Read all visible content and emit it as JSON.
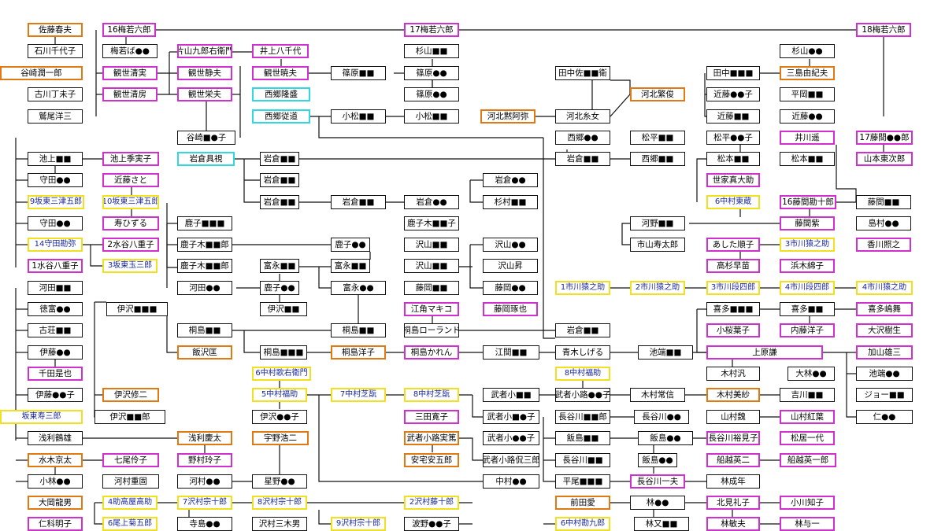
{
  "colors": {
    "black": "#111111",
    "orange": "#e07a10",
    "magenta": "#d030d0",
    "yellow": "#f0e020",
    "cyan": "#30d8e0",
    "blue_text": "#1a2aa0"
  },
  "nodes": [
    {
      "t": "佐藤春夫",
      "c": "o"
    },
    {
      "t": "石川千代子",
      "c": "b"
    },
    {
      "t": "谷崎潤一郎",
      "c": "o"
    },
    {
      "t": "古川丁未子",
      "c": "b"
    },
    {
      "t": "鷲尾洋三",
      "c": "b"
    },
    {
      "t": "16梅若六郎",
      "c": "m"
    },
    {
      "t": "梅若ば●●",
      "c": "b"
    },
    {
      "t": "観世清実",
      "c": "m"
    },
    {
      "t": "観世清房",
      "c": "m"
    },
    {
      "t": "片山九郎右衛門",
      "c": "m"
    },
    {
      "t": "観世静夫",
      "c": "m"
    },
    {
      "t": "観世栄夫",
      "c": "m"
    },
    {
      "t": "井上八千代",
      "c": "m"
    },
    {
      "t": "観世暁夫",
      "c": "m"
    },
    {
      "t": "西郷隆盛",
      "c": "c"
    },
    {
      "t": "西郷従道",
      "c": "c"
    },
    {
      "t": "17梅若六郎",
      "c": "m"
    },
    {
      "t": "篠原■■",
      "c": "b"
    },
    {
      "t": "篠原●●",
      "c": "b"
    },
    {
      "t": "篠原●●",
      "c": "b"
    },
    {
      "t": "小松■■",
      "c": "b"
    },
    {
      "t": "小松■■",
      "c": "b"
    },
    {
      "t": "杉山■■",
      "c": "b"
    },
    {
      "t": "田中佐■■衛",
      "c": "b"
    },
    {
      "t": "河北繁俊",
      "c": "o"
    },
    {
      "t": "河北黙阿弥",
      "c": "o"
    },
    {
      "t": "河北糸女",
      "c": "b"
    },
    {
      "t": "田中■■■",
      "c": "b"
    },
    {
      "t": "近藤●●子",
      "c": "b"
    },
    {
      "t": "近藤■■",
      "c": "b"
    },
    {
      "t": "杉山●●",
      "c": "b"
    },
    {
      "t": "三島由紀夫",
      "c": "o"
    },
    {
      "t": "平岡■■",
      "c": "b"
    },
    {
      "t": "近藤●●",
      "c": "b"
    },
    {
      "t": "18梅若六郎",
      "c": "m"
    },
    {
      "t": "谷崎■●子",
      "c": "b"
    },
    {
      "t": "西郷●●",
      "c": "b"
    },
    {
      "t": "松平■■",
      "c": "b"
    },
    {
      "t": "松平●●子",
      "c": "b"
    },
    {
      "t": "井川遥",
      "c": "m"
    },
    {
      "t": "17藤間●●郎",
      "c": "m"
    },
    {
      "t": "池上■■",
      "c": "b"
    },
    {
      "t": "池上季実子",
      "c": "m"
    },
    {
      "t": "岩倉具視",
      "c": "c"
    },
    {
      "t": "岩倉■■",
      "c": "b"
    },
    {
      "t": "岩倉■■",
      "c": "b"
    },
    {
      "t": "西郷■■",
      "c": "b"
    },
    {
      "t": "松本■■",
      "c": "b"
    },
    {
      "t": "松本■■",
      "c": "b"
    },
    {
      "t": "山本東次郎",
      "c": "m"
    },
    {
      "t": "守田●●",
      "c": "b"
    },
    {
      "t": "近藤さと",
      "c": "m"
    },
    {
      "t": "岩倉■■",
      "c": "b"
    },
    {
      "t": "岩倉●●",
      "c": "b"
    },
    {
      "t": "世家真大助",
      "c": "m"
    },
    {
      "t": "9坂東三津五郎",
      "c": "y"
    },
    {
      "t": "10坂東三津五郎",
      "c": "y"
    },
    {
      "t": "岩倉■■",
      "c": "b"
    },
    {
      "t": "岩倉■■",
      "c": "b"
    },
    {
      "t": "岩倉●●",
      "c": "b"
    },
    {
      "t": "杉村■■",
      "c": "b"
    },
    {
      "t": "6中村東蔵",
      "c": "y"
    },
    {
      "t": "16藤間勘十郎",
      "c": "m"
    },
    {
      "t": "藤間■■",
      "c": "b"
    },
    {
      "t": "守田●●",
      "c": "b"
    },
    {
      "t": "寿ひずる",
      "c": "m"
    },
    {
      "t": "鹿子■■■",
      "c": "b"
    },
    {
      "t": "鹿子木■■子",
      "c": "b"
    },
    {
      "t": "河野■■",
      "c": "b"
    },
    {
      "t": "藤間紫",
      "c": "m"
    },
    {
      "t": "島村●●",
      "c": "b"
    },
    {
      "t": "14守田勘弥",
      "c": "y"
    },
    {
      "t": "2水谷八重子",
      "c": "m"
    },
    {
      "t": "鹿子木■■郎",
      "c": "b"
    },
    {
      "t": "沢山■■",
      "c": "b"
    },
    {
      "t": "沢山●●",
      "c": "b"
    },
    {
      "t": "市山寿太郎",
      "c": "b"
    },
    {
      "t": "あした順子",
      "c": "m"
    },
    {
      "t": "3市川猿之助",
      "c": "y"
    },
    {
      "t": "香川照之",
      "c": "m"
    },
    {
      "t": "1水谷八重子",
      "c": "m"
    },
    {
      "t": "3坂東玉三郎",
      "c": "y"
    },
    {
      "t": "鹿子木■■郎",
      "c": "b"
    },
    {
      "t": "富永■■",
      "c": "b"
    },
    {
      "t": "鹿子●●",
      "c": "b"
    },
    {
      "t": "富永■■",
      "c": "b"
    },
    {
      "t": "沢山■■",
      "c": "b"
    },
    {
      "t": "沢山昇",
      "c": "b"
    },
    {
      "t": "浜木綿子",
      "c": "m"
    },
    {
      "t": "河田■■",
      "c": "b"
    },
    {
      "t": "河田●●",
      "c": "b"
    },
    {
      "t": "鹿子●●",
      "c": "b"
    },
    {
      "t": "富永●●",
      "c": "b"
    },
    {
      "t": "藤岡■■",
      "c": "b"
    },
    {
      "t": "藤岡●●",
      "c": "b"
    },
    {
      "t": "高杉早苗",
      "c": "m"
    },
    {
      "t": "1市川猿之助",
      "c": "y"
    },
    {
      "t": "2市川猿之助",
      "c": "y"
    },
    {
      "t": "3市川段四郎",
      "c": "y"
    },
    {
      "t": "4市川段四郎",
      "c": "y"
    },
    {
      "t": "4市川猿之助",
      "c": "y"
    },
    {
      "t": "徳富●●",
      "c": "b"
    },
    {
      "t": "伊沢■■■",
      "c": "b"
    },
    {
      "t": "伊沢■■",
      "c": "b"
    },
    {
      "t": "江角マキコ",
      "c": "m"
    },
    {
      "t": "藤岡琢也",
      "c": "m"
    },
    {
      "t": "喜多■■■",
      "c": "b"
    },
    {
      "t": "喜多■■",
      "c": "b"
    },
    {
      "t": "喜多嶋舞",
      "c": "m"
    },
    {
      "t": "古荘■■",
      "c": "b"
    },
    {
      "t": "桐島■■",
      "c": "b"
    },
    {
      "t": "桐島■■",
      "c": "b"
    },
    {
      "t": "桐島ローランド",
      "c": "b"
    },
    {
      "t": "岩倉■■",
      "c": "b"
    },
    {
      "t": "小桜葉子",
      "c": "m"
    },
    {
      "t": "内藤洋子",
      "c": "m"
    },
    {
      "t": "大沢樹生",
      "c": "m"
    },
    {
      "t": "伊藤●●",
      "c": "b"
    },
    {
      "t": "飯沢匡",
      "c": "o"
    },
    {
      "t": "桐島■■■",
      "c": "b"
    },
    {
      "t": "桐島洋子",
      "c": "o"
    },
    {
      "t": "桐島かれん",
      "c": "m"
    },
    {
      "t": "江間■■",
      "c": "b"
    },
    {
      "t": "青木しげる",
      "c": "b"
    },
    {
      "t": "池端■■",
      "c": "b"
    },
    {
      "t": "上原謙",
      "c": "m"
    },
    {
      "t": "加山雄三",
      "c": "m"
    },
    {
      "t": "千田是也",
      "c": "m"
    },
    {
      "t": "6中村歌右衛門",
      "c": "y"
    },
    {
      "t": "8中村福助",
      "c": "y"
    },
    {
      "t": "木村汎",
      "c": "b"
    },
    {
      "t": "大林●●",
      "c": "b"
    },
    {
      "t": "池端●●",
      "c": "b"
    },
    {
      "t": "伊藤●●子",
      "c": "b"
    },
    {
      "t": "伊沢修二",
      "c": "o"
    },
    {
      "t": "5中村福助",
      "c": "y"
    },
    {
      "t": "7中村芝翫",
      "c": "y"
    },
    {
      "t": "8中村芝翫",
      "c": "y"
    },
    {
      "t": "武者小■■",
      "c": "b"
    },
    {
      "t": "武者小路●●子",
      "c": "b"
    },
    {
      "t": "木村常信",
      "c": "b"
    },
    {
      "t": "木村美紗",
      "c": "o"
    },
    {
      "t": "吉川■■",
      "c": "b"
    },
    {
      "t": "ジョー■■",
      "c": "b"
    },
    {
      "t": "坂東寿三郎",
      "c": "y"
    },
    {
      "t": "伊沢■■郎",
      "c": "b"
    },
    {
      "t": "伊沢●●子",
      "c": "b"
    },
    {
      "t": "三田寛子",
      "c": "m"
    },
    {
      "t": "武者小■●子",
      "c": "b"
    },
    {
      "t": "長谷川■■郎",
      "c": "b"
    },
    {
      "t": "長谷川●●",
      "c": "b"
    },
    {
      "t": "山村魏",
      "c": "b"
    },
    {
      "t": "山村紅葉",
      "c": "m"
    },
    {
      "t": "仁●●",
      "c": "b"
    },
    {
      "t": "浅利鶴雄",
      "c": "b"
    },
    {
      "t": "浅利慶太",
      "c": "o"
    },
    {
      "t": "宇野浩二",
      "c": "o"
    },
    {
      "t": "武者小路実篤",
      "c": "o"
    },
    {
      "t": "武者小●●子",
      "c": "b"
    },
    {
      "t": "飯島■■",
      "c": "b"
    },
    {
      "t": "飯島●●",
      "c": "b"
    },
    {
      "t": "長谷川裕見子",
      "c": "m"
    },
    {
      "t": "松居一代",
      "c": "m"
    },
    {
      "t": "水木京太",
      "c": "o"
    },
    {
      "t": "七尾伶子",
      "c": "m"
    },
    {
      "t": "野村玲子",
      "c": "m"
    },
    {
      "t": "安宅安五郎",
      "c": "o"
    },
    {
      "t": "武者小路侃三郎",
      "c": "b"
    },
    {
      "t": "長谷川■■",
      "c": "b"
    },
    {
      "t": "飯島●●",
      "c": "b"
    },
    {
      "t": "船越英二",
      "c": "m"
    },
    {
      "t": "船越英一郎",
      "c": "m"
    },
    {
      "t": "小林●●",
      "c": "b"
    },
    {
      "t": "河村重固",
      "c": "b"
    },
    {
      "t": "河村●●",
      "c": "b"
    },
    {
      "t": "星野●●",
      "c": "b"
    },
    {
      "t": "中村●●",
      "c": "b"
    },
    {
      "t": "平尾■■■",
      "c": "b"
    },
    {
      "t": "長谷川一夫",
      "c": "m"
    },
    {
      "t": "林成年",
      "c": "b"
    },
    {
      "t": "大岡龍男",
      "c": "o"
    },
    {
      "t": "4助高屋高助",
      "c": "y"
    },
    {
      "t": "7沢村宗十郎",
      "c": "y"
    },
    {
      "t": "8沢村宗十郎",
      "c": "y"
    },
    {
      "t": "2沢村藤十郎",
      "c": "y"
    },
    {
      "t": "前田愛",
      "c": "o"
    },
    {
      "t": "林●●",
      "c": "b"
    },
    {
      "t": "北見礼子",
      "c": "m"
    },
    {
      "t": "小川知子",
      "c": "m"
    },
    {
      "t": "仁科明子",
      "c": "m"
    },
    {
      "t": "6尾上菊五郎",
      "c": "y"
    },
    {
      "t": "寺島●●",
      "c": "b"
    },
    {
      "t": "沢村三木男",
      "c": "b"
    },
    {
      "t": "9沢村宗十郎",
      "c": "y"
    },
    {
      "t": "波野●●子",
      "c": "b"
    },
    {
      "t": "6中村勘九郎",
      "c": "y"
    },
    {
      "t": "林又■■",
      "c": "b"
    },
    {
      "t": "林敏夫",
      "c": "m"
    },
    {
      "t": "林与一",
      "c": "m"
    }
  ]
}
